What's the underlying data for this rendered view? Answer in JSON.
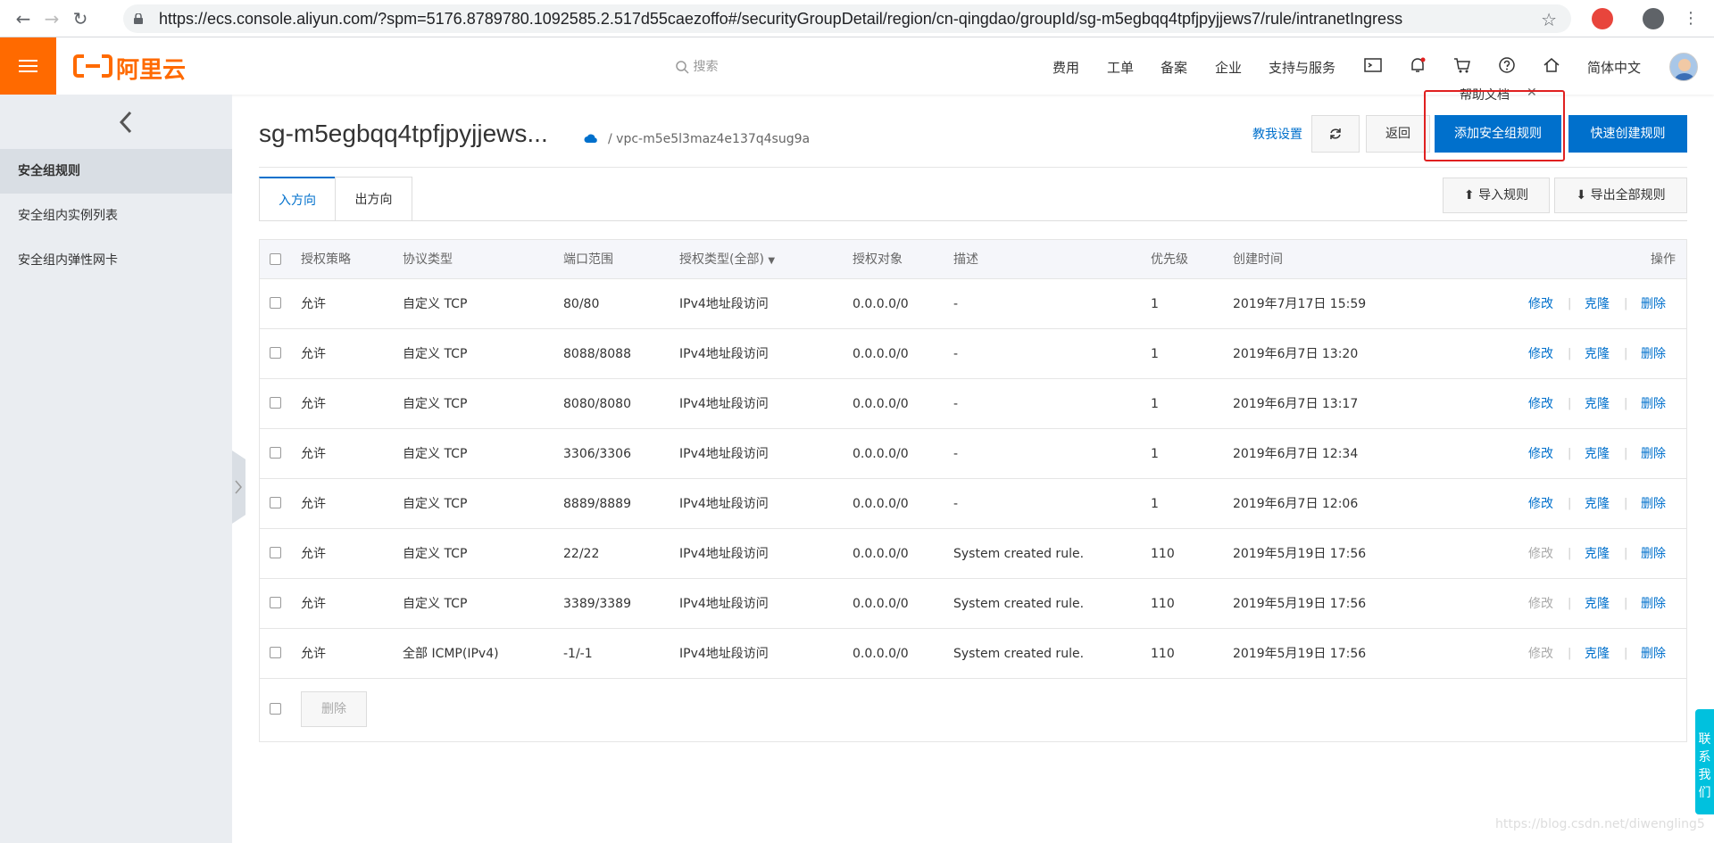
{
  "browser": {
    "url": "https://ecs.console.aliyun.com/?spm=5176.8789780.1092585.2.517d55caezoffo#/securityGroupDetail/region/cn-qingdao/groupId/sg-m5egbqq4tpfjpyjjews7/rule/intranetIngress"
  },
  "topbar": {
    "logo_text": "阿里云",
    "search_placeholder": "搜索",
    "menu": [
      "费用",
      "工单",
      "备案",
      "企业",
      "支持与服务"
    ],
    "language": "简体中文",
    "brand_color": "#ff6a00"
  },
  "sidebar": {
    "items": [
      {
        "label": "安全组规则",
        "active": true
      },
      {
        "label": "安全组内实例列表",
        "active": false
      },
      {
        "label": "安全组内弹性网卡",
        "active": false
      }
    ]
  },
  "header": {
    "title": "sg-m5egbqq4tpfjpyjjews...",
    "vpc": "/ vpc-m5e5l3maz4e137q4sug9a",
    "guide_link": "教我设置",
    "back_button": "返回",
    "add_rule_button": "添加安全组规则",
    "quick_create_button": "快速创建规则",
    "help_tip": "帮助文档",
    "accent_color": "#0070cc"
  },
  "tabs": [
    {
      "label": "入方向",
      "active": true
    },
    {
      "label": "出方向",
      "active": false
    }
  ],
  "actions": {
    "import_button": "导入规则",
    "export_button": "导出全部规则"
  },
  "table": {
    "columns": [
      "授权策略",
      "协议类型",
      "端口范围",
      "授权类型(全部)",
      "授权对象",
      "描述",
      "优先级",
      "创建时间",
      "操作"
    ],
    "rows": [
      {
        "policy": "允许",
        "protocol": "自定义 TCP",
        "port": "80/80",
        "auth_type": "IPv4地址段访问",
        "object": "0.0.0.0/0",
        "desc": "-",
        "priority": "1",
        "created": "2019年7月17日 15:59",
        "edit_disabled": false
      },
      {
        "policy": "允许",
        "protocol": "自定义 TCP",
        "port": "8088/8088",
        "auth_type": "IPv4地址段访问",
        "object": "0.0.0.0/0",
        "desc": "-",
        "priority": "1",
        "created": "2019年6月7日 13:20",
        "edit_disabled": false
      },
      {
        "policy": "允许",
        "protocol": "自定义 TCP",
        "port": "8080/8080",
        "auth_type": "IPv4地址段访问",
        "object": "0.0.0.0/0",
        "desc": "-",
        "priority": "1",
        "created": "2019年6月7日 13:17",
        "edit_disabled": false
      },
      {
        "policy": "允许",
        "protocol": "自定义 TCP",
        "port": "3306/3306",
        "auth_type": "IPv4地址段访问",
        "object": "0.0.0.0/0",
        "desc": "-",
        "priority": "1",
        "created": "2019年6月7日 12:34",
        "edit_disabled": false
      },
      {
        "policy": "允许",
        "protocol": "自定义 TCP",
        "port": "8889/8889",
        "auth_type": "IPv4地址段访问",
        "object": "0.0.0.0/0",
        "desc": "-",
        "priority": "1",
        "created": "2019年6月7日 12:06",
        "edit_disabled": false
      },
      {
        "policy": "允许",
        "protocol": "自定义 TCP",
        "port": "22/22",
        "auth_type": "IPv4地址段访问",
        "object": "0.0.0.0/0",
        "desc": "System created rule.",
        "priority": "110",
        "created": "2019年5月19日 17:56",
        "edit_disabled": true
      },
      {
        "policy": "允许",
        "protocol": "自定义 TCP",
        "port": "3389/3389",
        "auth_type": "IPv4地址段访问",
        "object": "0.0.0.0/0",
        "desc": "System created rule.",
        "priority": "110",
        "created": "2019年5月19日 17:56",
        "edit_disabled": true
      },
      {
        "policy": "允许",
        "protocol": "全部 ICMP(IPv4)",
        "port": "-1/-1",
        "auth_type": "IPv4地址段访问",
        "object": "0.0.0.0/0",
        "desc": "System created rule.",
        "priority": "110",
        "created": "2019年5月19日 17:56",
        "edit_disabled": true
      }
    ],
    "op_edit": "修改",
    "op_clone": "克隆",
    "op_delete": "删除",
    "bulk_delete": "删除"
  },
  "contact": "联系我们",
  "watermark": "https://blog.csdn.net/diwengling5"
}
